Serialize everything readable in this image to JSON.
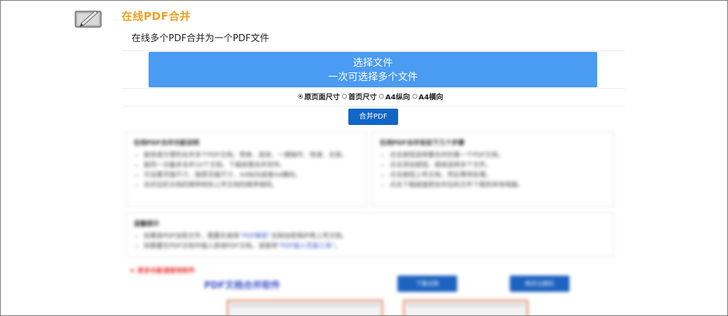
{
  "header": {
    "logo_icon": "pen-and-paper-icon",
    "title": "在线PDF合并",
    "subtitle": "在线多个PDF合并为一个PDF文件",
    "title_color": "#f0a020"
  },
  "upload": {
    "line1": "选择文件",
    "line2": "一次可选择多个文件",
    "color": "#4a9bf2"
  },
  "size_options": {
    "selected": "原页面尺寸",
    "items": [
      {
        "label": "原页面尺寸",
        "checked": true
      },
      {
        "label": "首页尺寸",
        "checked": false
      },
      {
        "label": "A4纵向",
        "checked": false
      },
      {
        "label": "A4横向",
        "checked": false
      }
    ]
  },
  "merge_button": {
    "label": "合并PDF",
    "color": "#1166c8"
  },
  "info_left": {
    "title": "在线PDF合并功能说明",
    "items": [
      "能快速方便的合并多个PDF文档，简单、高效、一键操作、快速、无损。",
      "能同一次最多合并10个文档，下载前需合并完毕。",
      "可设置页面尺寸，按原页面尺寸、A4纵向或者A4横向。",
      "合并后的文档的顺序和你上传文档的顺序相同。"
    ]
  },
  "info_right": {
    "title": "在线PDF合并有如下几个步骤",
    "items": [
      "点击按钮选择要合并的第一个PDF文档。",
      "点击添加按钮，继续选择多个文件。",
      "点击按钮上传文档，然后等待处理。",
      "点击下载链接把合并后的文件下载到本地电脑。"
    ]
  },
  "notes": {
    "title": "温馨提示",
    "items": [
      {
        "text": "如果是PDF加密文件，需要先使用",
        "link": "“PDF解密”",
        "suffix": "去除加密保护再上传文档。"
      },
      {
        "text": "如需要在PDF文档中插入其他PDF文档，请使用",
        "link": "“PDF插入页面工具”",
        "suffix": "。"
      }
    ]
  },
  "promo": {
    "title": "★ 更多功能请使用软件",
    "name": "PDF文档合并软件",
    "btn_download": "下载试用",
    "btn_buy": "购买注册码"
  }
}
